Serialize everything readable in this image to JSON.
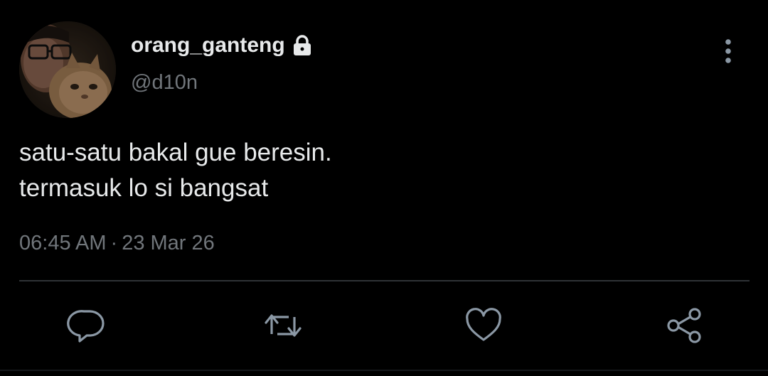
{
  "user": {
    "display_name": "orang_ganteng",
    "handle": "@d10n",
    "protected": true,
    "avatar_desc_icon": "profile-photo"
  },
  "tweet": {
    "lines": [
      "satu-satu bakal gue beresin.",
      "termasuk lo si bangsat"
    ]
  },
  "meta": {
    "time": "06:45 AM",
    "separator": "·",
    "date": "23 Mar 26"
  },
  "actions": {
    "reply_icon": "reply-icon",
    "retweet_icon": "retweet-icon",
    "like_icon": "heart-icon",
    "share_icon": "share-icon"
  },
  "colors": {
    "background": "#000000",
    "text": "#e7e9ea",
    "muted": "#71767b",
    "divider": "#2f3336"
  }
}
